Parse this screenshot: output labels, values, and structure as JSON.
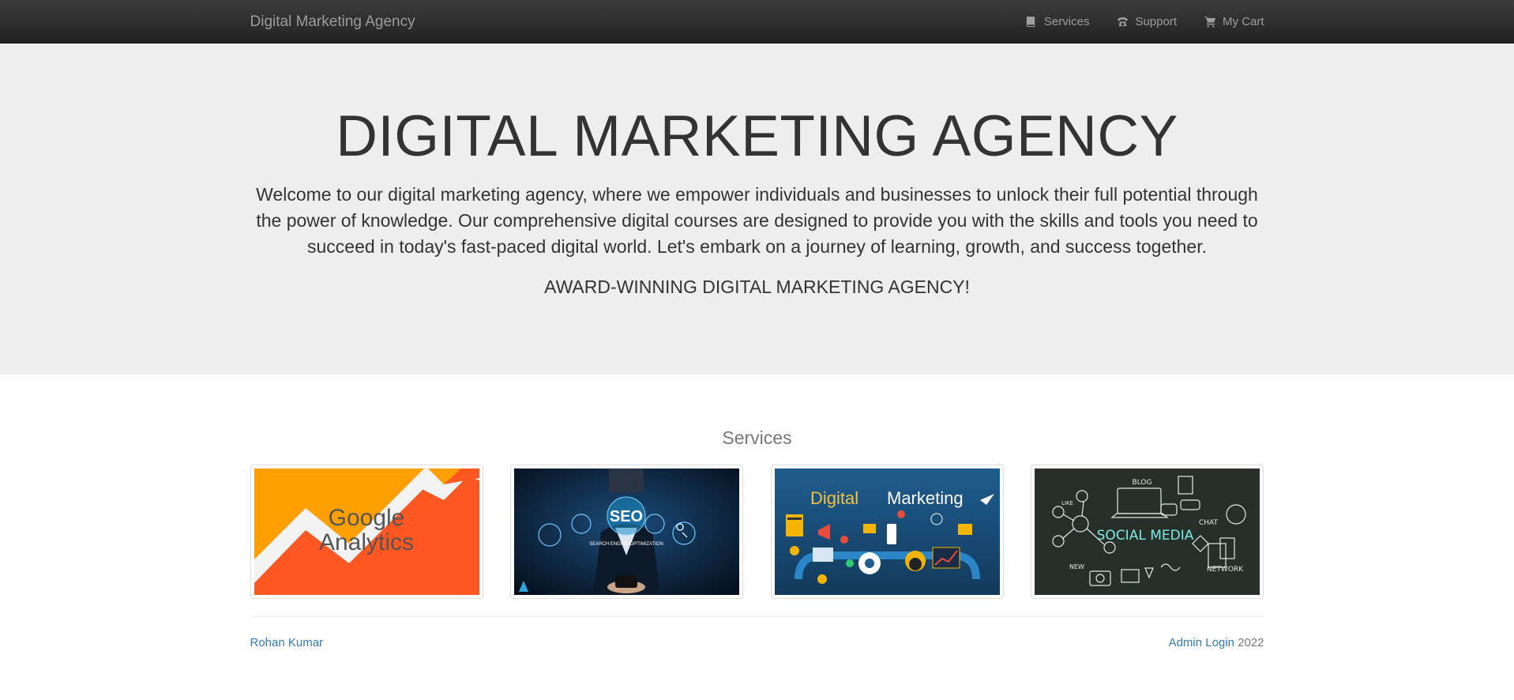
{
  "navbar": {
    "brand": "Digital Marketing Agency",
    "links": [
      {
        "label": "Services",
        "icon": "book-icon"
      },
      {
        "label": "Support",
        "icon": "phone-icon"
      },
      {
        "label": "My Cart",
        "icon": "cart-icon"
      }
    ]
  },
  "hero": {
    "title": "DIGITAL MARKETING AGENCY",
    "lead": "Welcome to our digital marketing agency, where we empower individuals and businesses to unlock their full potential through the power of knowledge. Our comprehensive digital courses are designed to provide you with the skills and tools you need to succeed in today's fast-paced digital world. Let's embark on a journey of learning, growth, and success together.",
    "tagline": "AWARD-WINNING DIGITAL MARKETING AGENCY!"
  },
  "services": {
    "title": "Services",
    "cards": [
      {
        "name": "google-analytics",
        "line1": "Google",
        "line2": "Analytics"
      },
      {
        "name": "seo",
        "text": "SEO",
        "subtext": "SEARCH ENGINE OPTIMIZATION"
      },
      {
        "name": "digital-marketing",
        "text_a": "Digital",
        "text_b": "Marketing"
      },
      {
        "name": "social-media",
        "text": "SOCIAL MEDIA",
        "blog": "BLOG",
        "chat": "CHAT",
        "network": "NETWORK",
        "like": "LIKE",
        "new": "NEW"
      }
    ]
  },
  "footer": {
    "author": "Rohan Kumar",
    "admin": "Admin Login",
    "year": "2022"
  },
  "colors": {
    "navbar": "#222222",
    "jumbotron": "#eeeeee",
    "link": "#337ab7",
    "analytics_orange": "#ff5722",
    "analytics_yellow": "#ffa000"
  }
}
